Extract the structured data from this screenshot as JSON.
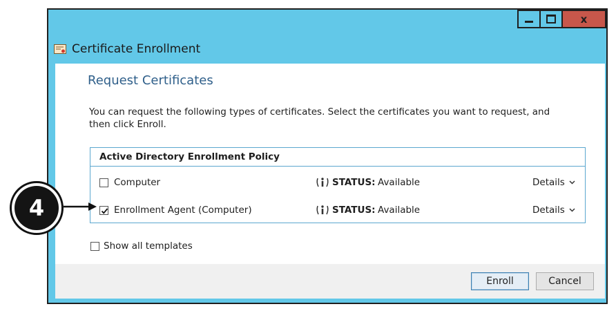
{
  "window": {
    "title": "Certificate Enrollment",
    "controls": {
      "close": "x"
    },
    "colors": {
      "frame": "#62c8e8",
      "close": "#c7574b",
      "heading": "#2f5f8a",
      "border": "#5ba7cf"
    }
  },
  "page": {
    "heading": "Request Certificates",
    "description": "You can request the following types of certificates. Select the certificates you want to request, and then click Enroll."
  },
  "policy": {
    "title": "Active Directory Enrollment Policy",
    "items": [
      {
        "label": "Computer",
        "checked": false,
        "status_key": "STATUS:",
        "status_value": "Available",
        "details": "Details"
      },
      {
        "label": "Enrollment Agent (Computer)",
        "checked": true,
        "status_key": "STATUS:",
        "status_value": "Available",
        "details": "Details"
      }
    ]
  },
  "show_all": {
    "label": "Show all templates",
    "checked": false
  },
  "footer": {
    "enroll": "Enroll",
    "cancel": "Cancel"
  },
  "callout": {
    "number": "4"
  },
  "icons": [
    "certificate-icon",
    "info-icon",
    "chevron-down-icon",
    "minimize-icon",
    "maximize-icon",
    "close-icon",
    "arrow-icon"
  ]
}
